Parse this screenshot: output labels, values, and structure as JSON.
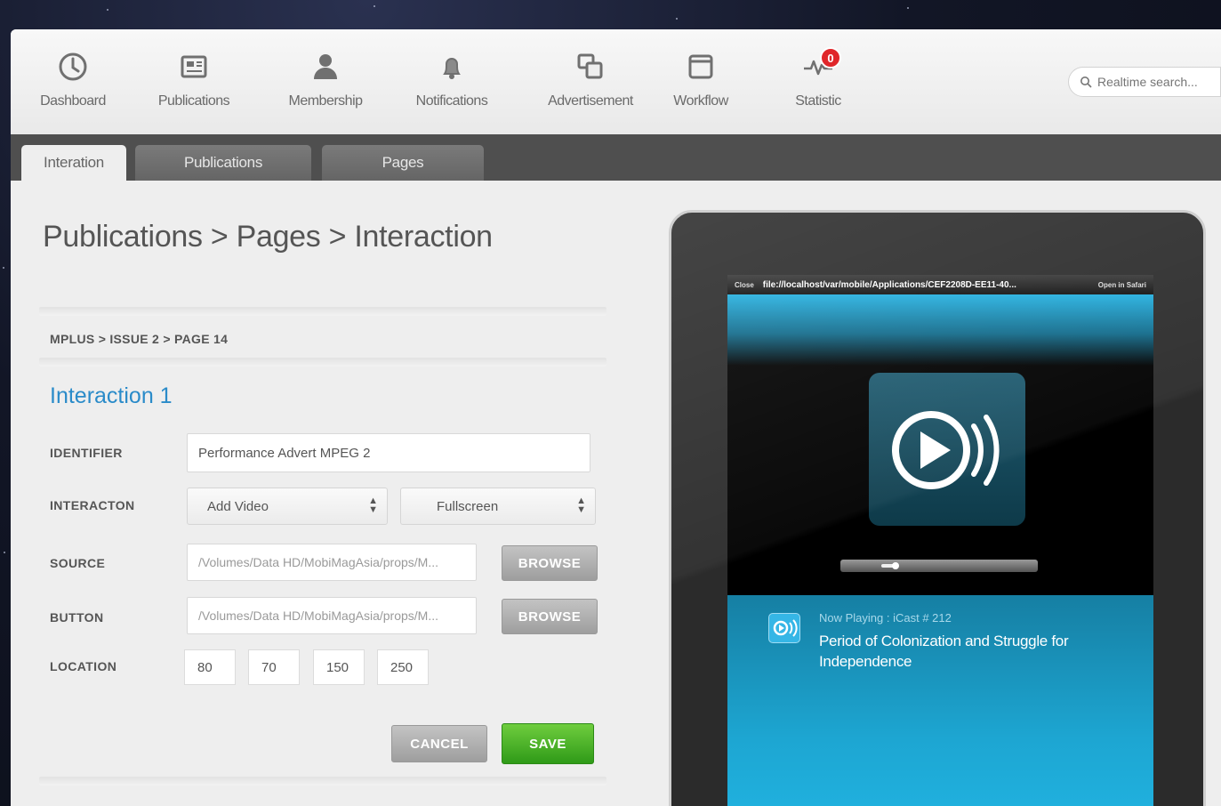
{
  "toolbar": {
    "items": [
      {
        "label": "Dashboard",
        "icon": "clock-icon"
      },
      {
        "label": "Publications",
        "icon": "newspaper-icon"
      },
      {
        "label": "Membership",
        "icon": "user-icon"
      },
      {
        "label": "Notifications",
        "icon": "bell-icon"
      },
      {
        "label": "Advertisement",
        "icon": "windows-icon"
      },
      {
        "label": "Workflow",
        "icon": "window-icon"
      },
      {
        "label": "Statistic",
        "icon": "pulse-icon"
      }
    ],
    "statistic_badge": "0",
    "search_placeholder": "Realtime search..."
  },
  "tabs": [
    {
      "label": "Interation",
      "active": true
    },
    {
      "label": "Publications",
      "active": false
    },
    {
      "label": "Pages",
      "active": false
    }
  ],
  "page": {
    "breadcrumb": "Publications > Pages > Interaction",
    "sub_breadcrumb": "MPLUS > ISSUE 2 > PAGE 14",
    "section_title": "Interaction 1"
  },
  "form": {
    "identifier_label": "IDENTIFIER",
    "identifier_value": "Performance Advert MPEG 2",
    "interaction_label": "INTERACTON",
    "interaction_type": "Add Video",
    "interaction_mode": "Fullscreen",
    "source_label": "SOURCE",
    "source_value": "/Volumes/Data HD/MobiMagAsia/props/M...",
    "button_label": "BUTTON",
    "button_value": "/Volumes/Data HD/MobiMagAsia/props/M...",
    "browse_label": "BROWSE",
    "location_label": "LOCATION",
    "location": [
      "80",
      "70",
      "150",
      "250"
    ],
    "cancel_label": "CANCEL",
    "save_label": "SAVE"
  },
  "preview": {
    "close_label": "Close",
    "url": "file://localhost/var/mobile/Applications/CEF2208D-EE11-40...",
    "open_label": "Open in Safari",
    "now_playing_label": "Now Playing : iCast # 212",
    "now_playing_title": "Period of Colonization and Struggle for Independence"
  },
  "colors": {
    "accent_blue": "#2a8bc9",
    "save_green": "#3aa320",
    "badge_red": "#e0262a",
    "player_cyan": "#1da6d2"
  }
}
